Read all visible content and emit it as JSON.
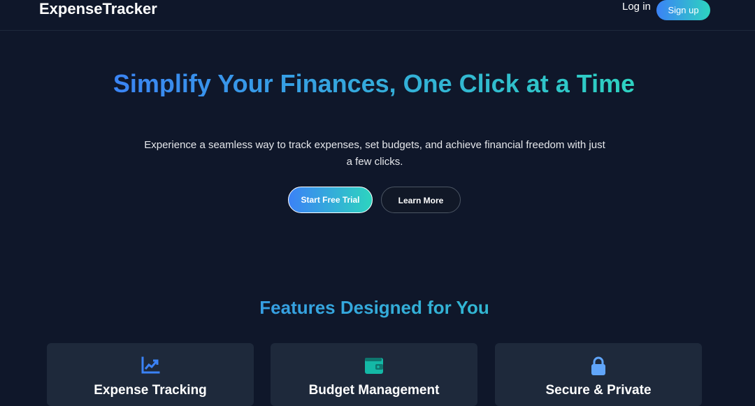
{
  "nav": {
    "brand": "ExpenseTracker",
    "login_label": "Log in",
    "signup_label": "Sign up"
  },
  "hero": {
    "title": "Simplify Your Finances, One Click at a Time",
    "subtitle": "Experience a seamless way to track expenses, set budgets, and achieve financial freedom with just a few clicks.",
    "primary_cta": "Start Free Trial",
    "secondary_cta": "Learn More"
  },
  "features": {
    "title": "Features Designed for You",
    "items": [
      {
        "title": "Expense Tracking",
        "icon": "chart-line-icon",
        "icon_color": "#3b82f6"
      },
      {
        "title": "Budget Management",
        "icon": "wallet-icon",
        "icon_color": "#14b8a6"
      },
      {
        "title": "Secure & Private",
        "icon": "lock-icon",
        "icon_color": "#60a5fa"
      }
    ]
  },
  "colors": {
    "background": "#0f172a",
    "card": "#1e293b",
    "accent_blue": "#3b82f6",
    "accent_teal": "#2dd4bf"
  }
}
